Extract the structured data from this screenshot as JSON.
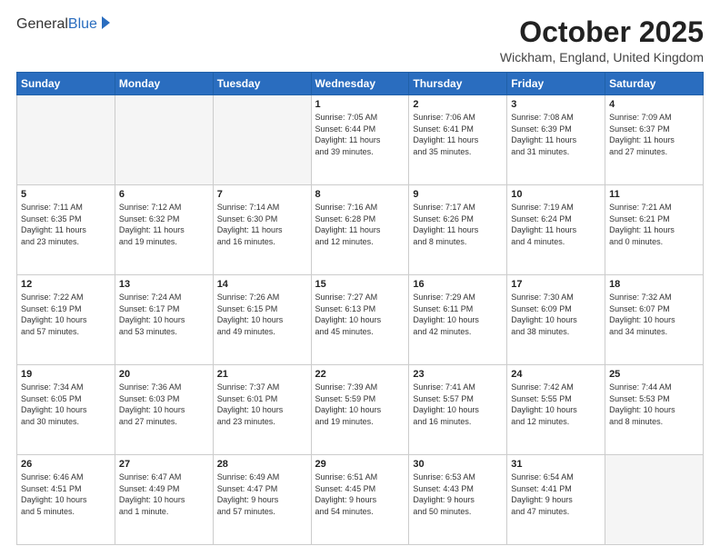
{
  "header": {
    "logo_general": "General",
    "logo_blue": "Blue",
    "month_title": "October 2025",
    "location": "Wickham, England, United Kingdom"
  },
  "days_of_week": [
    "Sunday",
    "Monday",
    "Tuesday",
    "Wednesday",
    "Thursday",
    "Friday",
    "Saturday"
  ],
  "weeks": [
    [
      {
        "day": "",
        "info": ""
      },
      {
        "day": "",
        "info": ""
      },
      {
        "day": "",
        "info": ""
      },
      {
        "day": "1",
        "info": "Sunrise: 7:05 AM\nSunset: 6:44 PM\nDaylight: 11 hours\nand 39 minutes."
      },
      {
        "day": "2",
        "info": "Sunrise: 7:06 AM\nSunset: 6:41 PM\nDaylight: 11 hours\nand 35 minutes."
      },
      {
        "day": "3",
        "info": "Sunrise: 7:08 AM\nSunset: 6:39 PM\nDaylight: 11 hours\nand 31 minutes."
      },
      {
        "day": "4",
        "info": "Sunrise: 7:09 AM\nSunset: 6:37 PM\nDaylight: 11 hours\nand 27 minutes."
      }
    ],
    [
      {
        "day": "5",
        "info": "Sunrise: 7:11 AM\nSunset: 6:35 PM\nDaylight: 11 hours\nand 23 minutes."
      },
      {
        "day": "6",
        "info": "Sunrise: 7:12 AM\nSunset: 6:32 PM\nDaylight: 11 hours\nand 19 minutes."
      },
      {
        "day": "7",
        "info": "Sunrise: 7:14 AM\nSunset: 6:30 PM\nDaylight: 11 hours\nand 16 minutes."
      },
      {
        "day": "8",
        "info": "Sunrise: 7:16 AM\nSunset: 6:28 PM\nDaylight: 11 hours\nand 12 minutes."
      },
      {
        "day": "9",
        "info": "Sunrise: 7:17 AM\nSunset: 6:26 PM\nDaylight: 11 hours\nand 8 minutes."
      },
      {
        "day": "10",
        "info": "Sunrise: 7:19 AM\nSunset: 6:24 PM\nDaylight: 11 hours\nand 4 minutes."
      },
      {
        "day": "11",
        "info": "Sunrise: 7:21 AM\nSunset: 6:21 PM\nDaylight: 11 hours\nand 0 minutes."
      }
    ],
    [
      {
        "day": "12",
        "info": "Sunrise: 7:22 AM\nSunset: 6:19 PM\nDaylight: 10 hours\nand 57 minutes."
      },
      {
        "day": "13",
        "info": "Sunrise: 7:24 AM\nSunset: 6:17 PM\nDaylight: 10 hours\nand 53 minutes."
      },
      {
        "day": "14",
        "info": "Sunrise: 7:26 AM\nSunset: 6:15 PM\nDaylight: 10 hours\nand 49 minutes."
      },
      {
        "day": "15",
        "info": "Sunrise: 7:27 AM\nSunset: 6:13 PM\nDaylight: 10 hours\nand 45 minutes."
      },
      {
        "day": "16",
        "info": "Sunrise: 7:29 AM\nSunset: 6:11 PM\nDaylight: 10 hours\nand 42 minutes."
      },
      {
        "day": "17",
        "info": "Sunrise: 7:30 AM\nSunset: 6:09 PM\nDaylight: 10 hours\nand 38 minutes."
      },
      {
        "day": "18",
        "info": "Sunrise: 7:32 AM\nSunset: 6:07 PM\nDaylight: 10 hours\nand 34 minutes."
      }
    ],
    [
      {
        "day": "19",
        "info": "Sunrise: 7:34 AM\nSunset: 6:05 PM\nDaylight: 10 hours\nand 30 minutes."
      },
      {
        "day": "20",
        "info": "Sunrise: 7:36 AM\nSunset: 6:03 PM\nDaylight: 10 hours\nand 27 minutes."
      },
      {
        "day": "21",
        "info": "Sunrise: 7:37 AM\nSunset: 6:01 PM\nDaylight: 10 hours\nand 23 minutes."
      },
      {
        "day": "22",
        "info": "Sunrise: 7:39 AM\nSunset: 5:59 PM\nDaylight: 10 hours\nand 19 minutes."
      },
      {
        "day": "23",
        "info": "Sunrise: 7:41 AM\nSunset: 5:57 PM\nDaylight: 10 hours\nand 16 minutes."
      },
      {
        "day": "24",
        "info": "Sunrise: 7:42 AM\nSunset: 5:55 PM\nDaylight: 10 hours\nand 12 minutes."
      },
      {
        "day": "25",
        "info": "Sunrise: 7:44 AM\nSunset: 5:53 PM\nDaylight: 10 hours\nand 8 minutes."
      }
    ],
    [
      {
        "day": "26",
        "info": "Sunrise: 6:46 AM\nSunset: 4:51 PM\nDaylight: 10 hours\nand 5 minutes."
      },
      {
        "day": "27",
        "info": "Sunrise: 6:47 AM\nSunset: 4:49 PM\nDaylight: 10 hours\nand 1 minute."
      },
      {
        "day": "28",
        "info": "Sunrise: 6:49 AM\nSunset: 4:47 PM\nDaylight: 9 hours\nand 57 minutes."
      },
      {
        "day": "29",
        "info": "Sunrise: 6:51 AM\nSunset: 4:45 PM\nDaylight: 9 hours\nand 54 minutes."
      },
      {
        "day": "30",
        "info": "Sunrise: 6:53 AM\nSunset: 4:43 PM\nDaylight: 9 hours\nand 50 minutes."
      },
      {
        "day": "31",
        "info": "Sunrise: 6:54 AM\nSunset: 4:41 PM\nDaylight: 9 hours\nand 47 minutes."
      },
      {
        "day": "",
        "info": ""
      }
    ]
  ]
}
